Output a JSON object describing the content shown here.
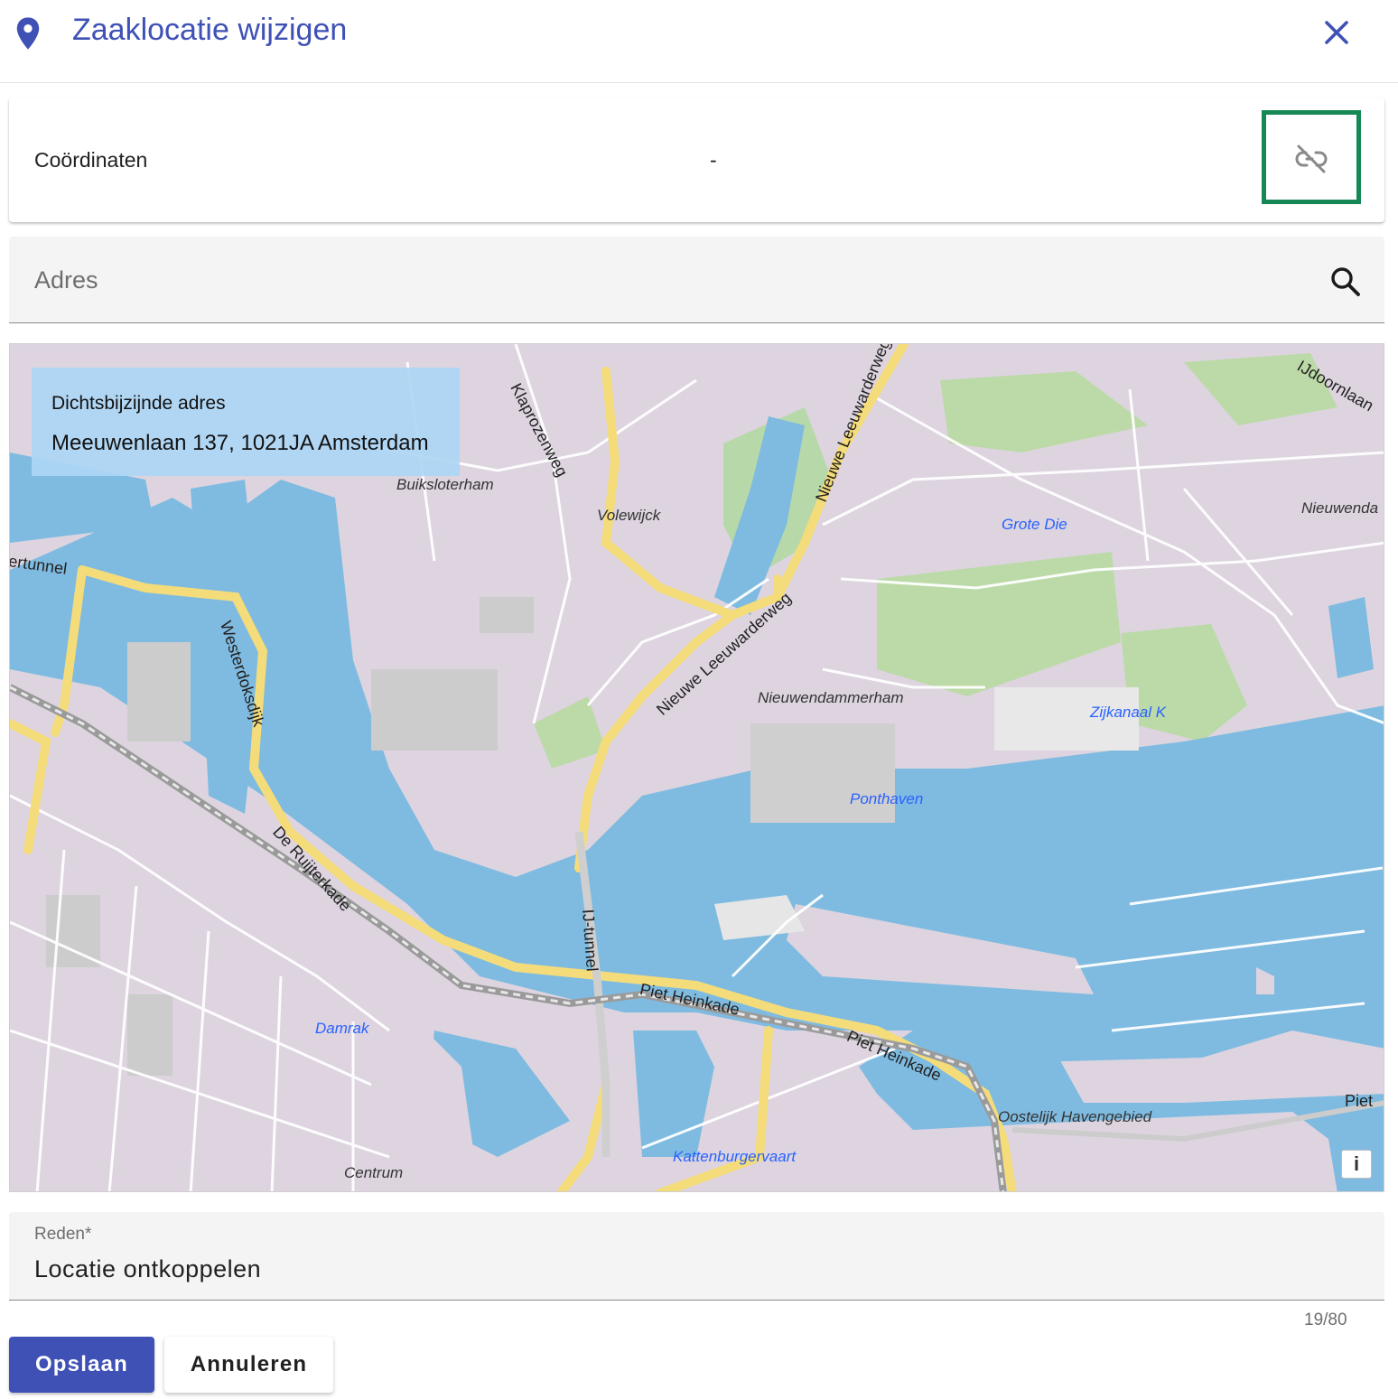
{
  "header": {
    "title": "Zaaklocatie wijzigen",
    "icon": "location-pin-icon",
    "close_icon": "close-icon",
    "accent_color": "#3f51b5"
  },
  "coordinates": {
    "label": "Coördinaten",
    "value": "-",
    "unlink_icon": "link-off-icon",
    "highlight_color": "#188756"
  },
  "address": {
    "placeholder": "Adres",
    "value": "",
    "icon": "search-icon"
  },
  "map": {
    "nearest_title": "Dichtsbijzijnde adres",
    "nearest_address": "Meeuwenlaan 137, 1021JA Amsterdam",
    "info_label": "i",
    "labels": {
      "klaprozenweg": "Klaprozenweg",
      "nieuwe_leeuwarderweg_top": "Nieuwe Leeuwarderweg",
      "ijdoornlaan": "IJdoornlaan",
      "buiksloterham": "Buiksloterham",
      "volewijck": "Volewijck",
      "grote_die": "Grote Die",
      "nieuwendam": "Nieuwenda",
      "ertunnel": "ertunnel",
      "westerdoksdijk": "Westerdoksdijk",
      "nieuwe_leeuwarderweg": "Nieuwe Leeuwarderweg",
      "nieuwendammerham": "Nieuwendammerham",
      "zijkanaal_k": "Zijkanaal K",
      "ponthaven": "Ponthaven",
      "de_ruijterkade": "De Ruijterkade",
      "ij_tunnel": "IJ-tunnel",
      "piet_heinkade_1": "Piet Heinkade",
      "piet_heinkade_2": "Piet Heinkade",
      "damrak": "Damrak",
      "oostelijk_havengebied": "Oostelijk Havengebied",
      "piet_edge": "Piet",
      "kattenburgervaart": "Kattenburgervaart",
      "centrum": "Centrum"
    }
  },
  "reason": {
    "label": "Reden*",
    "value": "Locatie ontkoppelen",
    "counter": "19/80"
  },
  "actions": {
    "save_label": "Opslaan",
    "cancel_label": "Annuleren"
  }
}
